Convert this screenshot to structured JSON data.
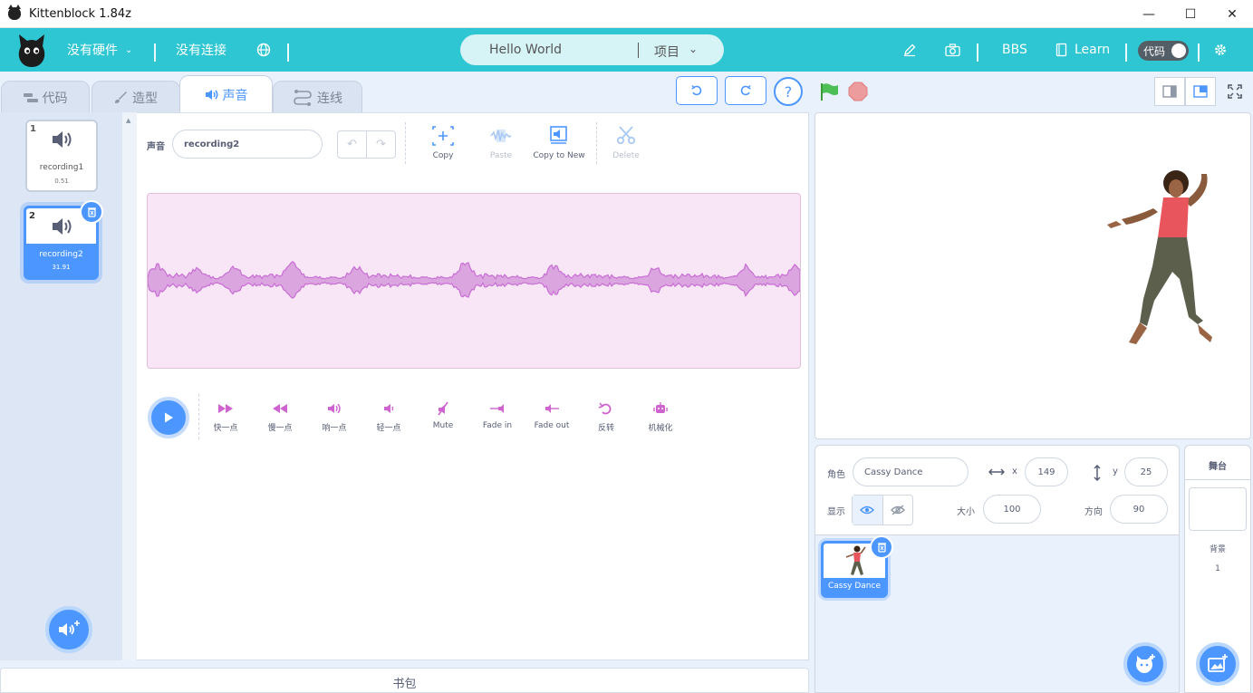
{
  "window": {
    "title": "Kittenblock 1.84z",
    "min": "—",
    "max": "☐",
    "close": "✕"
  },
  "menubar": {
    "hardware": "没有硬件",
    "connection": "没有连接",
    "project_name": "Hello World",
    "project_menu": "项目",
    "bbs": "BBS",
    "learn": "Learn",
    "code_toggle": "代码"
  },
  "tabs": [
    {
      "label": "代码",
      "icon": "code-icon"
    },
    {
      "label": "造型",
      "icon": "brush-icon"
    },
    {
      "label": "声音",
      "icon": "speaker-icon"
    },
    {
      "label": "连线",
      "icon": "wire-icon"
    }
  ],
  "sounds": [
    {
      "index": "1",
      "name": "recording1",
      "duration": "0.51"
    },
    {
      "index": "2",
      "name": "recording2",
      "duration": "31.91"
    }
  ],
  "editor": {
    "sound_label": "声音",
    "sound_name": "recording2",
    "tools": {
      "copy": "Copy",
      "paste": "Paste",
      "copy_to_new": "Copy to New",
      "delete": "Delete"
    },
    "effects": {
      "faster": "快一点",
      "slower": "慢一点",
      "louder": "响一点",
      "softer": "轻一点",
      "mute": "Mute",
      "fade_in": "Fade in",
      "fade_out": "Fade out",
      "reverse": "反转",
      "robot": "机械化"
    }
  },
  "backpack": "书包",
  "sprite": {
    "label": "角色",
    "name": "Cassy Dance",
    "x_label": "x",
    "x": "149",
    "y_label": "y",
    "y": "25",
    "show_label": "显示",
    "size_label": "大小",
    "size": "100",
    "direction_label": "方向",
    "direction": "90",
    "tile_name": "Cassy Dance"
  },
  "stage_pane": {
    "title": "舞台",
    "backdrop_label": "背景",
    "backdrop_count": "1"
  },
  "colors": {
    "menubar": "#2fc6d3",
    "accent": "#4c97ff",
    "waveform": "#c86ed4"
  }
}
